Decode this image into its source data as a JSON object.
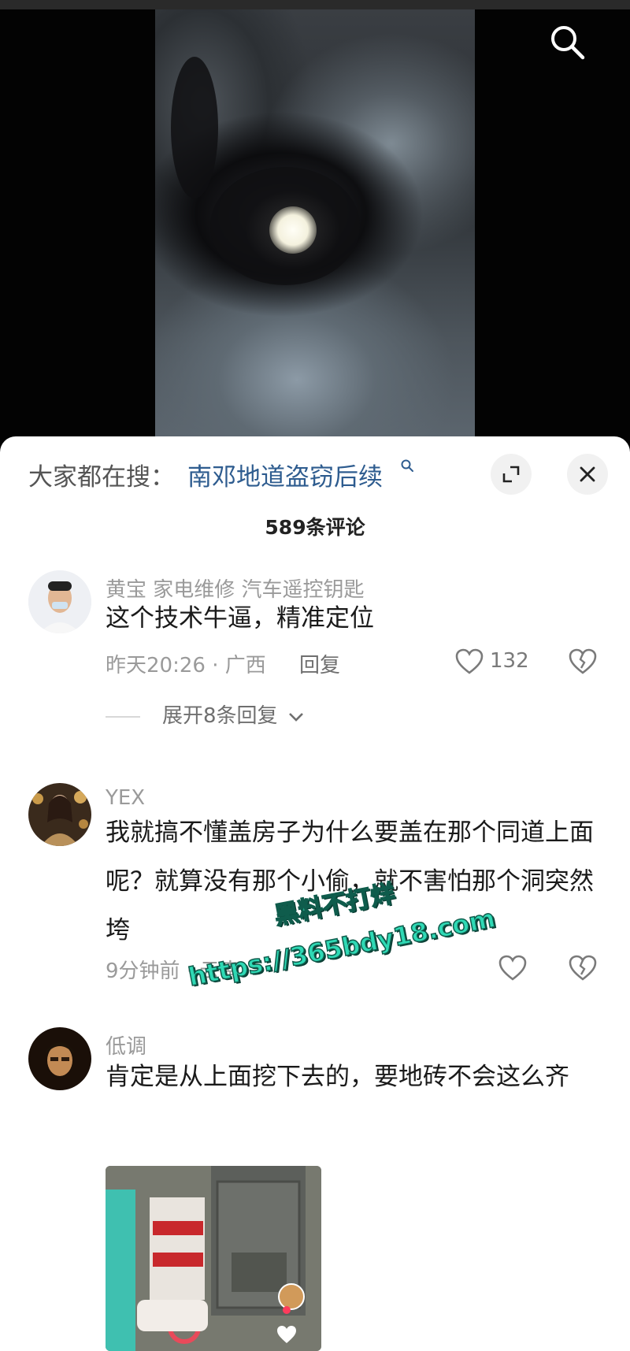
{
  "sheet": {
    "search_prefix": "大家都在搜：",
    "search_term": "南邓地道盗窃后续",
    "comment_count_title": "589条评论"
  },
  "comments": [
    {
      "username": "黄宝 家电维修 汽车遥控钥匙",
      "text": "这个技术牛逼，精准定位",
      "time_location": "昨天20:26 · 广西",
      "reply_label": "回复",
      "likes": "132",
      "expand_replies": "展开8条回复"
    },
    {
      "username": "YEX",
      "text": "我就搞不懂盖房子为什么要盖在那个同道上面呢？就算没有那个小偷，就不害怕那个洞突然垮",
      "time_location": "9分钟前 · 云南"
    },
    {
      "username": "低调",
      "text": "肯定是从上面挖下去的，要地砖不会这么齐"
    }
  ],
  "watermark": {
    "line1": "黑料不打烊",
    "line2": "https://365bdy18.com"
  },
  "colors": {
    "link_blue": "#2e5c8f",
    "watermark_green": "#2fd9b5",
    "meta_gray": "#9a9a9a"
  }
}
